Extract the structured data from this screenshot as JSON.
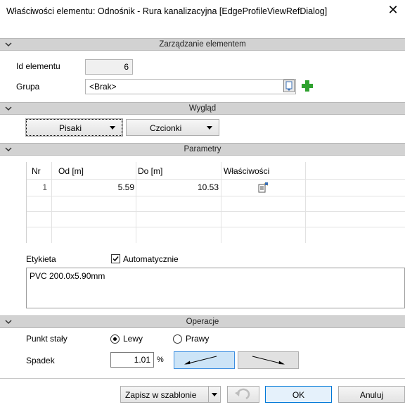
{
  "window": {
    "title": "Właściwości elementu: Odnośnik - Rura kanalizacyjna [EdgeProfileViewRefDialog]",
    "close_glyph": "✕"
  },
  "sections": {
    "management": "Zarządzanie elementem",
    "appearance": "Wygląd",
    "parameters": "Parametry",
    "operations": "Operacje"
  },
  "management": {
    "id_label": "Id elementu",
    "id_value": "6",
    "group_label": "Grupa",
    "group_value": "<Brak>"
  },
  "appearance": {
    "pens_label": "Pisaki",
    "fonts_label": "Czcionki"
  },
  "parameters": {
    "columns": [
      "Nr",
      "Od [m]",
      "Do [m]",
      "Właściwości"
    ],
    "rows": [
      {
        "nr": "1",
        "od": "5.59",
        "do": "10.53"
      }
    ]
  },
  "label_section": {
    "label": "Etykieta",
    "auto_label": "Automatycznie",
    "auto_checked": true,
    "text": "PVC 200.0x5.90mm"
  },
  "operations": {
    "fixed_point_label": "Punkt stały",
    "left_label": "Lewy",
    "right_label": "Prawy",
    "selected": "left",
    "slope_label": "Spadek",
    "slope_value": "1.01",
    "slope_unit": "%"
  },
  "footer": {
    "save_template_label": "Zapisz w szablonie",
    "ok_label": "OK",
    "cancel_label": "Anuluj"
  },
  "colors": {
    "section_bg": "#d2d2d2",
    "selected_blue": "#cce4f7",
    "green_plus": "#2ea12e"
  }
}
